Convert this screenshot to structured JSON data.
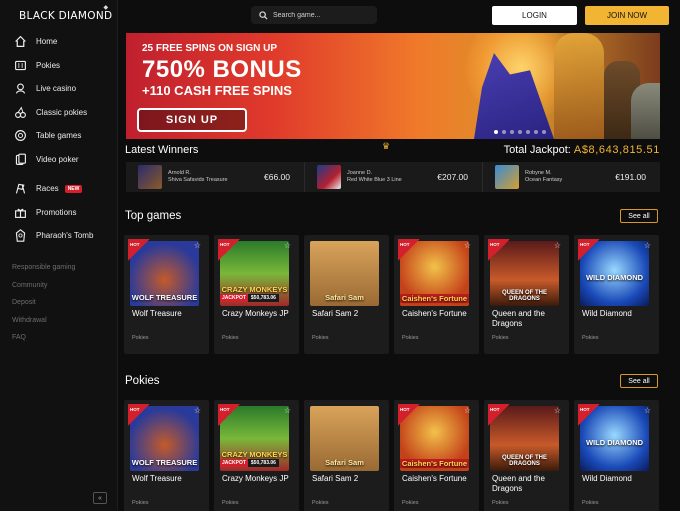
{
  "brand": {
    "name": "BLACK DIAMOND"
  },
  "search": {
    "placeholder": "Search game..."
  },
  "header": {
    "login": "LOGIN",
    "join": "JOIN NOW"
  },
  "sidebar": {
    "items": [
      {
        "label": "Home",
        "icon": "home-icon"
      },
      {
        "label": "Pokies",
        "icon": "slot-machine-icon"
      },
      {
        "label": "Live casino",
        "icon": "live-dealer-icon"
      },
      {
        "label": "Classic pokies",
        "icon": "cherry-icon"
      },
      {
        "label": "Table games",
        "icon": "chip-icon"
      },
      {
        "label": "Video poker",
        "icon": "cards-icon"
      },
      {
        "label": "Races",
        "icon": "racing-flags-icon",
        "badge": "NEW"
      },
      {
        "label": "Promotions",
        "icon": "gift-icon"
      },
      {
        "label": "Pharaoh's Tomb",
        "icon": "pharaoh-icon"
      }
    ],
    "links": [
      "Responsible gaming",
      "Community",
      "Deposit",
      "Withdrawal",
      "FAQ"
    ],
    "collapse": "«"
  },
  "banner": {
    "line1": "25 FREE SPINS ON SIGN UP",
    "line2": "750% BONUS",
    "line3": "+110 CASH FREE SPINS",
    "cta": "SIGN UP",
    "slides": 7,
    "active_slide": 1
  },
  "winners": {
    "title": "Latest Winners",
    "jackpot_label": "Total Jackpot:",
    "jackpot_value": "A$8,643,815.51",
    "entries": [
      {
        "name": "Arnold R.",
        "game": "Shiva Safavids Treasure",
        "amount": "€66.00"
      },
      {
        "name": "Joanne D.",
        "game": "Red White Blue 3 Line",
        "amount": "€207.00"
      },
      {
        "name": "Robyne M.",
        "game": "Ocean Fantasy",
        "amount": "€191.00"
      }
    ]
  },
  "top_games": {
    "title": "Top games",
    "see_all": "See all",
    "games": [
      {
        "name": "Wolf Treasure",
        "category": "Pokies",
        "hot": "HOT",
        "art": "WOLF TREASURE"
      },
      {
        "name": "Crazy Monkeys JP",
        "category": "Pokies",
        "hot": "HOT",
        "art": "CRAZY MONKEYS",
        "jackpot_label": "JACKPOT",
        "jackpot_value": "$50,783.06"
      },
      {
        "name": "Safari Sam 2",
        "category": "Pokies",
        "hot": "",
        "art": "Safari Sam"
      },
      {
        "name": "Caishen's Fortune",
        "category": "Pokies",
        "hot": "HOT",
        "art": "Caishen's Fortune"
      },
      {
        "name": "Queen and the Dragons",
        "category": "Pokies",
        "hot": "HOT",
        "art": "QUEEN OF THE DRAGONS"
      },
      {
        "name": "Wild Diamond",
        "category": "Pokies",
        "hot": "HOT",
        "art": "WILD DIAMOND"
      }
    ]
  },
  "pokies": {
    "title": "Pokies",
    "see_all": "See all",
    "games": [
      {
        "name": "Wolf Treasure",
        "category": "Pokies",
        "hot": "HOT",
        "art": "WOLF TREASURE"
      },
      {
        "name": "Crazy Monkeys JP",
        "category": "Pokies",
        "hot": "HOT",
        "art": "CRAZY MONKEYS",
        "jackpot_label": "JACKPOT",
        "jackpot_value": "$50,783.06"
      },
      {
        "name": "Safari Sam 2",
        "category": "Pokies",
        "hot": "",
        "art": "Safari Sam"
      },
      {
        "name": "Caishen's Fortune",
        "category": "Pokies",
        "hot": "HOT",
        "art": "Caishen's Fortune"
      },
      {
        "name": "Queen and the Dragons",
        "category": "Pokies",
        "hot": "HOT",
        "art": "QUEEN OF THE DRAGONS"
      },
      {
        "name": "Wild Diamond",
        "category": "Pokies",
        "hot": "HOT",
        "art": "WILD DIAMOND"
      }
    ]
  },
  "colors": {
    "accent": "#f2b533",
    "hot": "#d4202c",
    "background": "#0d0d0d"
  }
}
